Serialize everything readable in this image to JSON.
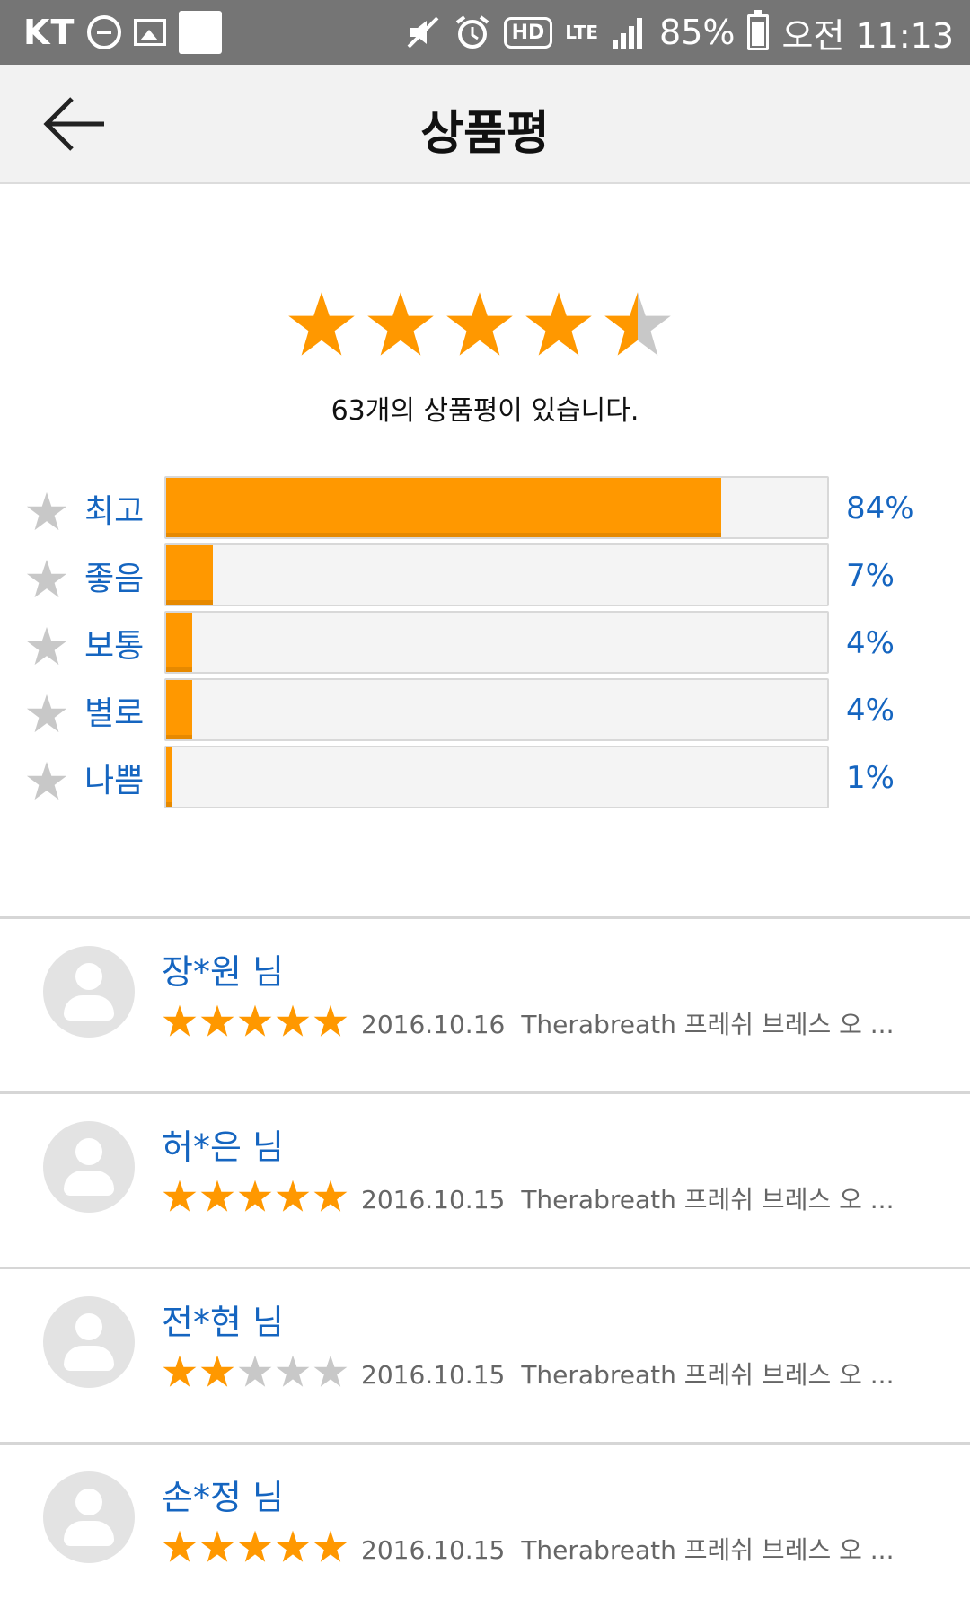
{
  "status_bar": {
    "carrier": "KT",
    "network": "LTE",
    "hd": "HD",
    "battery": "85%",
    "time": "오전 11:13"
  },
  "appbar": {
    "title": "상품평",
    "back_icon": "arrow-back-icon"
  },
  "summary": {
    "rating": 4.5,
    "max_rating": 5,
    "count_text": "63개의 상품평이 있습니다."
  },
  "distribution": [
    {
      "label": "최고",
      "percent": 84,
      "percent_text": "84%"
    },
    {
      "label": "좋음",
      "percent": 7,
      "percent_text": "7%"
    },
    {
      "label": "보통",
      "percent": 4,
      "percent_text": "4%"
    },
    {
      "label": "별로",
      "percent": 4,
      "percent_text": "4%"
    },
    {
      "label": "나쁨",
      "percent": 1,
      "percent_text": "1%"
    }
  ],
  "reviews": [
    {
      "name": "장*원 님",
      "rating": 5,
      "date": "2016.10.16",
      "product": "Therabreath 프레쉬 브레스 오 ..."
    },
    {
      "name": "허*은 님",
      "rating": 5,
      "date": "2016.10.15",
      "product": "Therabreath 프레쉬 브레스 오 ..."
    },
    {
      "name": "전*현 님",
      "rating": 2,
      "date": "2016.10.15",
      "product": "Therabreath 프레쉬 브레스 오 ..."
    },
    {
      "name": "손*정 님",
      "rating": 5,
      "date": "2016.10.15",
      "product": "Therabreath 프레쉬 브레스 오 ..."
    }
  ],
  "colors": {
    "accent": "#ff9800",
    "link": "#1565c0",
    "star_empty": "#c8c8c8"
  }
}
